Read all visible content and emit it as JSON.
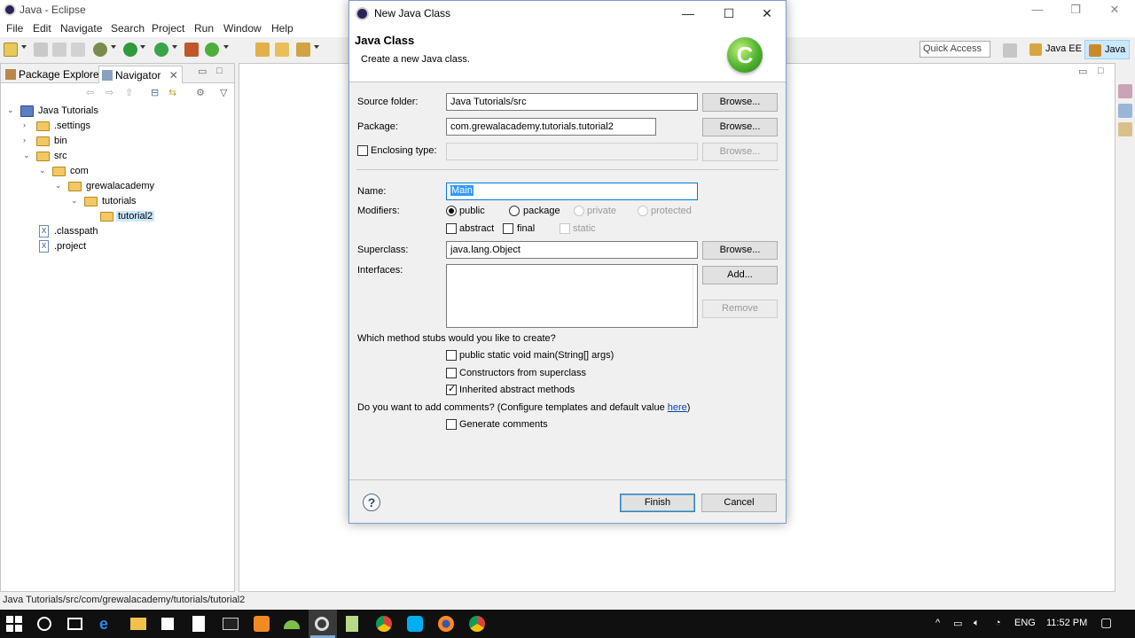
{
  "window": {
    "title": "Java - Eclipse"
  },
  "menu": [
    "File",
    "Edit",
    "Navigate",
    "Search",
    "Project",
    "Run",
    "Window",
    "Help"
  ],
  "toolbar": {
    "quick_access": "Quick Access",
    "perspective_javaee": "Java EE",
    "perspective_java": "Java"
  },
  "views": {
    "package_explorer": "Package Explorer",
    "navigator": "Navigator"
  },
  "tree": [
    {
      "label": "Java Tutorials",
      "type": "project",
      "level": 0
    },
    {
      "label": ".settings",
      "type": "folder",
      "level": 1
    },
    {
      "label": "bin",
      "type": "folder",
      "level": 1
    },
    {
      "label": "src",
      "type": "folder",
      "level": 1
    },
    {
      "label": "com",
      "type": "folder",
      "level": 2
    },
    {
      "label": "grewalacademy",
      "type": "folder",
      "level": 3
    },
    {
      "label": "tutorials",
      "type": "folder",
      "level": 4
    },
    {
      "label": "tutorial2",
      "type": "folder",
      "level": 5,
      "selected": true
    },
    {
      "label": ".classpath",
      "type": "file",
      "level": 1
    },
    {
      "label": ".project",
      "type": "file",
      "level": 1
    }
  ],
  "status": "Java Tutorials/src/com/grewalacademy/tutorials/tutorial2",
  "dialog": {
    "title": "New Java Class",
    "heading": "Java Class",
    "subheading": "Create a new Java class.",
    "source_folder_label": "Source folder:",
    "source_folder_value": "Java Tutorials/src",
    "package_label": "Package:",
    "package_value": "com.grewalacademy.tutorials.tutorial2",
    "enclosing_label": "Enclosing type:",
    "browse": "Browse...",
    "name_label": "Name:",
    "name_value": "Main",
    "modifiers_label": "Modifiers:",
    "mod_public": "public",
    "mod_package": "package",
    "mod_private": "private",
    "mod_protected": "protected",
    "mod_abstract": "abstract",
    "mod_final": "final",
    "mod_static": "static",
    "superclass_label": "Superclass:",
    "superclass_value": "java.lang.Object",
    "interfaces_label": "Interfaces:",
    "add": "Add...",
    "remove": "Remove",
    "stubs_question": "Which method stubs would you like to create?",
    "stub_main": "public static void main(String[] args)",
    "stub_constructors": "Constructors from superclass",
    "stub_inherited": "Inherited abstract methods",
    "comments_question_prefix": "Do you want to add comments? (Configure templates and default value ",
    "comments_link": "here",
    "comments_question_suffix": ")",
    "generate_comments": "Generate comments",
    "finish": "Finish",
    "cancel": "Cancel",
    "help_glyph": "?"
  },
  "taskbar": {
    "language": "ENG",
    "time": "11:52 PM"
  }
}
